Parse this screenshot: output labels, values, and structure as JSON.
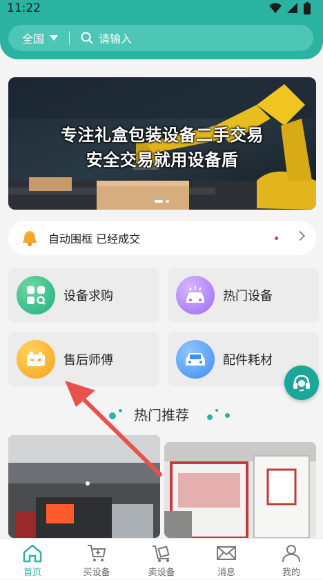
{
  "status": {
    "time": "11:22"
  },
  "search": {
    "region": "全国",
    "placeholder": "请输入"
  },
  "banner": {
    "line1": "专注礼盒包装设备二手交易",
    "line2": "安全交易就用设备盾"
  },
  "notice": {
    "text": "自动围框 已经成交"
  },
  "tiles": [
    {
      "label": "设备求购",
      "icon": "grid-search-icon"
    },
    {
      "label": "热门设备",
      "icon": "hot-car-icon"
    },
    {
      "label": "售后师傅",
      "icon": "battery-icon"
    },
    {
      "label": "配件耗材",
      "icon": "car-icon"
    }
  ],
  "section": {
    "title": "热门推荐"
  },
  "tabs": [
    {
      "label": "首页",
      "icon": "home-icon",
      "active": true
    },
    {
      "label": "买设备",
      "icon": "cart-icon",
      "active": false
    },
    {
      "label": "卖设备",
      "icon": "box-cart-icon",
      "active": false
    },
    {
      "label": "消息",
      "icon": "mail-icon",
      "active": false
    },
    {
      "label": "我的",
      "icon": "user-icon",
      "active": false
    }
  ],
  "colors": {
    "brand": "#2bb3a2",
    "annotation_arrow": "#e8514c"
  }
}
